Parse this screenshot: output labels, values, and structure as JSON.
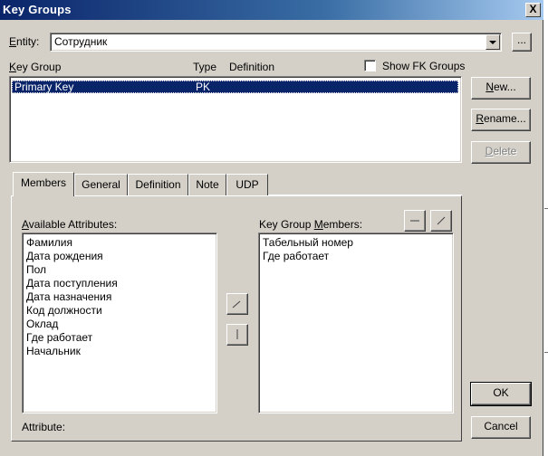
{
  "window": {
    "title": "Key Groups",
    "close_glyph": "X"
  },
  "entity": {
    "label": "Entity:",
    "value": "Сотрудник",
    "browse_label": "..."
  },
  "key_group_list": {
    "columns": {
      "key_group": "Key Group",
      "type": "Type",
      "definition": "Definition"
    },
    "rows": [
      {
        "key_group": "Primary Key",
        "type": "PK",
        "definition": ""
      }
    ]
  },
  "show_fk": {
    "label": "Show FK Groups",
    "checked": false
  },
  "buttons": {
    "new": "New...",
    "rename": "Rename...",
    "delete": "Delete",
    "ok": "OK",
    "cancel": "Cancel"
  },
  "tabs": [
    "Members",
    "General",
    "Definition",
    "Note",
    "UDP"
  ],
  "active_tab": "Members",
  "members": {
    "available_label": "Available Attributes:",
    "available": [
      "Фамилия",
      "Дата рождения",
      "Пол",
      "Дата поступления",
      "Дата назначения",
      "Код должности",
      "Оклад",
      "Где работает",
      "Начальник"
    ],
    "members_label": "Key Group Members:",
    "members": [
      "Табельный номер",
      "Где работает"
    ],
    "attribute_label": "Attribute:"
  }
}
